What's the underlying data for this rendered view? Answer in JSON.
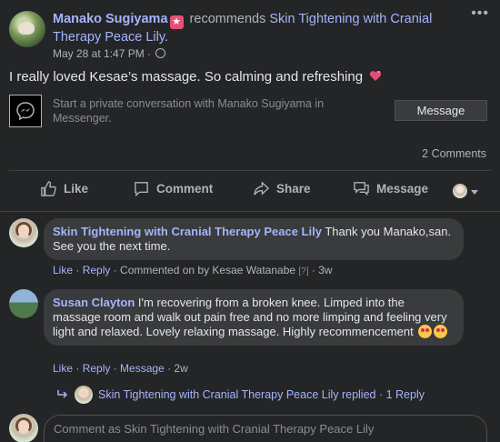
{
  "post": {
    "author": "Manako Sugiyama",
    "recommends_text": "recommends",
    "page_name": "Skin Tightening with Cranial Therapy Peace Lily.",
    "date": "May 28 at 1:47 PM ·",
    "more_label": "•••",
    "text": "I really loved Kesae’s massage. So calming and refreshing",
    "messenger_prompt": "Start a private conversation with Manako Sugiyama in Messenger.",
    "message_button": "Message",
    "comments_count": "2 Comments"
  },
  "actions": {
    "like": "Like",
    "comment": "Comment",
    "share": "Share",
    "message": "Message"
  },
  "comments": [
    {
      "author": "Skin Tightening with Cranial Therapy Peace Lily",
      "text": " Thank you Manako,san. See you the next time.",
      "like": "Like",
      "reply": "Reply",
      "commented_on": "Commented on by Kesae Watanabe",
      "help": "[?]",
      "time": "3w"
    },
    {
      "author": "Susan Clayton",
      "text": " I'm recovering from a broken knee. Limped into the massage room and walk out pain free and no more limping and feeling very light and relaxed. Lovely relaxing massage. Highly recommencement",
      "like": "Like",
      "reply": "Reply",
      "message": "Message",
      "time": "2w"
    }
  ],
  "reply_summary": {
    "text": "Skin Tightening with Cranial Therapy Peace Lily replied · 1 Reply"
  },
  "composer": {
    "placeholder": "Comment as Skin Tightening with Cranial Therapy Peace Lily"
  },
  "colors": {
    "background": "#242526",
    "link": "#a5b4fc",
    "muted": "#b0b3b8"
  }
}
